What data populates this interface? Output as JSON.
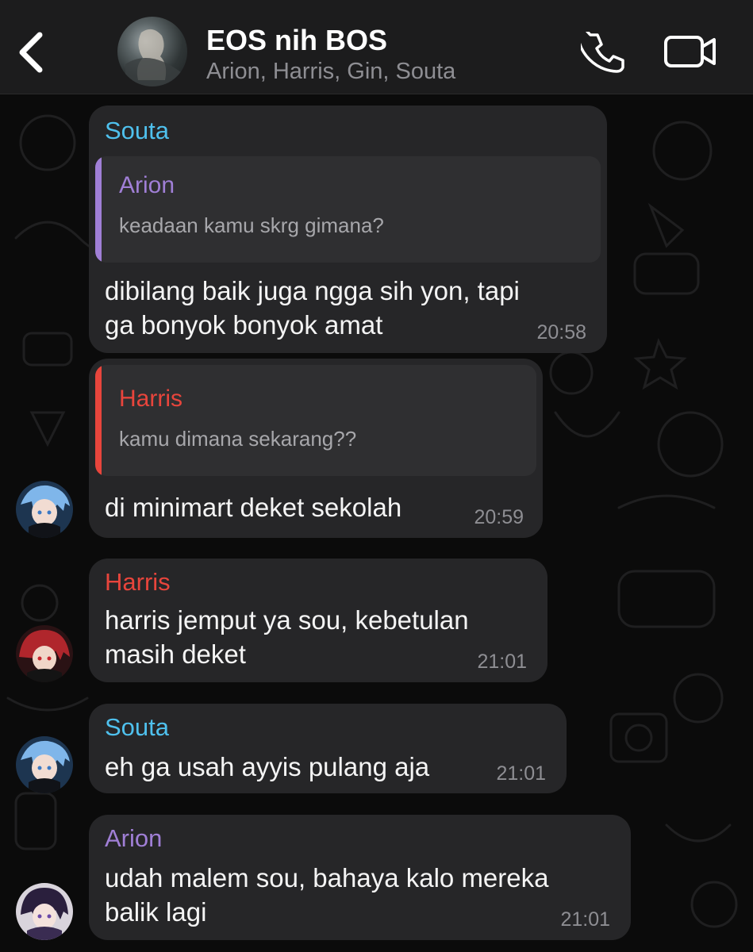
{
  "header": {
    "back_icon": "chevron-left-icon",
    "title": "EOS nih BOS",
    "members": "Arion, Harris, Gin, Souta",
    "call_icon": "phone-icon",
    "video_icon": "video-camera-icon"
  },
  "colors": {
    "souta": "#4fc1ee",
    "arion": "#a07fd6",
    "harris": "#e8453c",
    "bubble": "#262628",
    "quote": "#2f2f31",
    "time": "#8e8e93"
  },
  "messages": [
    {
      "sender": "Souta",
      "reply": {
        "name": "Arion",
        "text": "keadaan kamu skrg gimana?"
      },
      "text": "dibilang baik juga ngga sih yon, tapi\nga bonyok bonyok amat",
      "time": "20:58"
    },
    {
      "sender": "",
      "reply": {
        "name": "Harris",
        "text": "kamu dimana sekarang??"
      },
      "text": "di minimart deket sekolah",
      "time": "20:59"
    },
    {
      "sender": "Harris",
      "text": "harris jemput ya sou, kebetulan\nmasih deket",
      "time": "21:01"
    },
    {
      "sender": "Souta",
      "text": "eh ga usah ayyis pulang aja",
      "time": "21:01"
    },
    {
      "sender": "Arion",
      "text": "udah malem sou, bahaya kalo mereka\nbalik lagi",
      "time": "21:01"
    }
  ]
}
